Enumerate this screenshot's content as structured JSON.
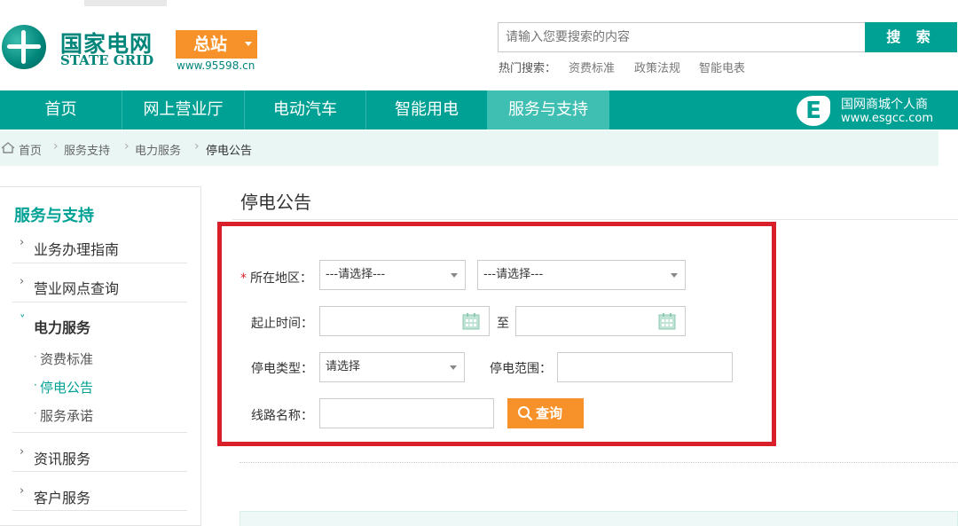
{
  "header": {
    "logo_cn": "国家电网",
    "logo_en": "STATE GRID",
    "station_label": "总站",
    "site_url": "www.95598.cn",
    "search": {
      "placeholder": "请输入您要搜索的内容",
      "button_label": "搜 索"
    },
    "hot_search_label": "热门搜索：",
    "hot_links": [
      "资费标准",
      "政策法规",
      "智能电表"
    ]
  },
  "nav": {
    "items": [
      {
        "label": "首页",
        "active": false
      },
      {
        "label": "网上营业厅",
        "active": false
      },
      {
        "label": "电动汽车",
        "active": false
      },
      {
        "label": "智能用电",
        "active": false
      },
      {
        "label": "服务与支持",
        "active": true
      }
    ],
    "esgcc_badge": "E",
    "esgcc_cn": "国网商城个人商",
    "esgcc_url": "www.esgcc.com"
  },
  "breadcrumb": [
    "首页",
    "服务支持",
    "电力服务",
    "停电公告"
  ],
  "sidebar": {
    "title": "服务与支持",
    "items": [
      {
        "label": "业务办理指南",
        "expanded": false
      },
      {
        "label": "营业网点查询",
        "expanded": false
      },
      {
        "label": "电力服务",
        "expanded": true,
        "children": [
          {
            "label": "资费标准",
            "active": false
          },
          {
            "label": "停电公告",
            "active": true
          },
          {
            "label": "服务承诺",
            "active": false
          }
        ]
      },
      {
        "label": "资讯服务",
        "expanded": false
      },
      {
        "label": "客户服务",
        "expanded": false
      }
    ]
  },
  "main": {
    "title": "停电公告",
    "form": {
      "region_label": "所在地区：",
      "region_required_mark": "*",
      "region_select_1": "---请选择---",
      "region_select_2": "---请选择---",
      "time_label": "起止时间：",
      "time_to": "至",
      "type_label": "停电类型：",
      "type_select": "请选择",
      "range_label": "停电范围：",
      "line_label": "线路名称：",
      "query_button": "查询"
    }
  },
  "colors": {
    "brand": "#00a195",
    "accent": "#f7922b",
    "highlight_frame": "#d9202a"
  }
}
